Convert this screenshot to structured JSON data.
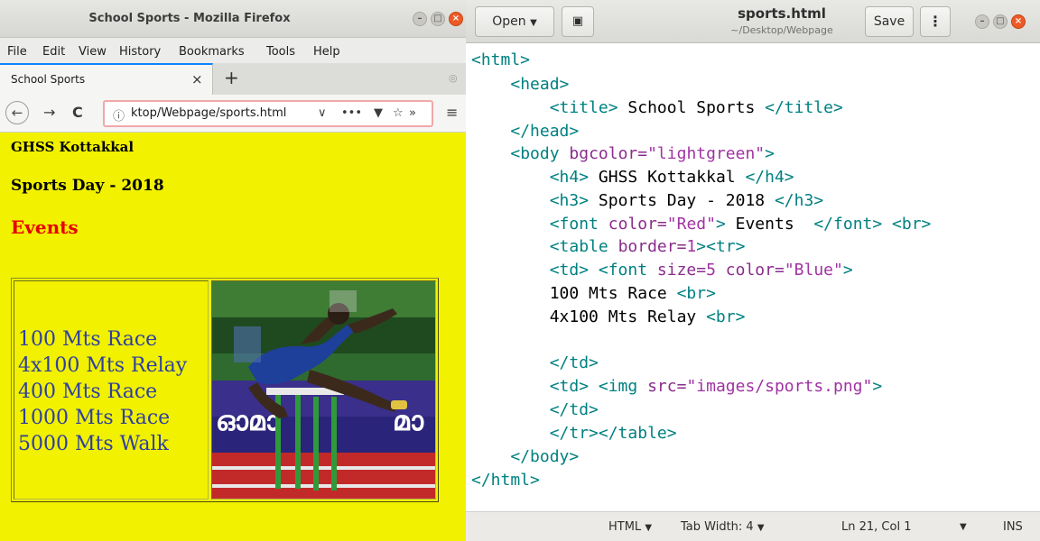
{
  "firefox": {
    "window_title": "School Sports - Mozilla Firefox",
    "menu": [
      "File",
      "Edit",
      "View",
      "History",
      "Bookmarks",
      "Tools",
      "Help"
    ],
    "tab": {
      "title": "School Sports",
      "close": "×",
      "new_tab": "+"
    },
    "urlbar": {
      "url": "ktop/Webpage/sports.html"
    },
    "window_controls": {
      "minimize": "–",
      "maximize": "□",
      "close": "×"
    }
  },
  "page": {
    "h4": "GHSS Kottakkal",
    "h3": "Sports Day - 2018",
    "events_heading": "Events",
    "events": [
      "100 Mts Race",
      "4x100 Mts Relay",
      "400 Mts Race",
      "1000 Mts Race",
      "5000 Mts Walk"
    ],
    "image_text": "ഓമാ",
    "image_text_right": "മാ"
  },
  "gedit": {
    "open_label": "Open",
    "title": "sports.html",
    "subtitle": "~/Desktop/Webpage",
    "save_label": "Save",
    "code": {
      "l1": "<html>",
      "l2": "<head>",
      "l3_open": "<title>",
      "l3_text": " School Sports ",
      "l3_close": "</title>",
      "l4": "</head>",
      "l5_tag": "<body ",
      "l5_attr": "bgcolor=",
      "l5_val": "\"lightgreen\"",
      "l5_end": ">",
      "l6_open": "<h4>",
      "l6_text": " GHSS Kottakkal ",
      "l6_close": "</h4>",
      "l7_open": "<h3>",
      "l7_text": " Sports Day - 2018 ",
      "l7_close": "</h3>",
      "l8_tag": "<font ",
      "l8_attr": "color=",
      "l8_val": "\"Red\"",
      "l8_end": ">",
      "l8_text": " Events  ",
      "l8_close": "</font> <br>",
      "l9_tag": "<table ",
      "l9_attr": "border=",
      "l9_val": "1",
      "l9_end": "><tr>",
      "l10_tag": "<td> <font ",
      "l10_attr1": "size=",
      "l10_val1": "5",
      "l10_attr2": " color=",
      "l10_val2": "\"Blue\"",
      "l10_end": ">",
      "l11_text": "100 Mts Race ",
      "l11_tag": "<br>",
      "l12_text": "4x100 Mts Relay ",
      "l12_tag": "<br>",
      "l13": "</td>",
      "l14_tag": "<td> <img ",
      "l14_attr": "src=",
      "l14_val": "\"images/sports.png\"",
      "l14_end": ">",
      "l15": "</td>",
      "l16": "</tr></table>",
      "l17": "</body>",
      "l18": "</html>"
    },
    "status": {
      "language": "HTML",
      "tab_width": "Tab Width: 4",
      "position": "Ln 21, Col 1",
      "mode": "INS"
    }
  }
}
